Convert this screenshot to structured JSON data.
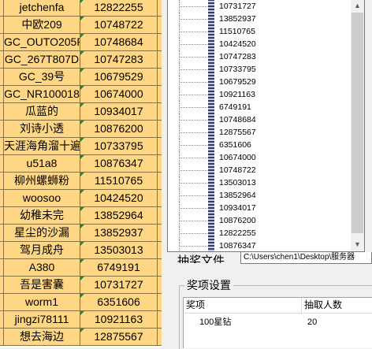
{
  "sheet": {
    "rows": [
      {
        "name": "jetchenfa",
        "value": "12822255"
      },
      {
        "name": "中欧209",
        "value": "10748722"
      },
      {
        "name": "GC_OUTO205R",
        "value": "10748684"
      },
      {
        "name": "GC_267T807D",
        "value": "10747283"
      },
      {
        "name": "GC_39号",
        "value": "10679529"
      },
      {
        "name": "GC_NR100018",
        "value": "10674000"
      },
      {
        "name": "瓜蓝的",
        "value": "10934017"
      },
      {
        "name": "刘诗小透",
        "value": "10876200"
      },
      {
        "name": "天涯海角溜十遍",
        "value": "10733795"
      },
      {
        "name": "u51a8",
        "value": "10876347"
      },
      {
        "name": "柳州螺蛳粉",
        "value": "11510765"
      },
      {
        "name": "woosoo",
        "value": "10424520"
      },
      {
        "name": "幼稚未完",
        "value": "13852964"
      },
      {
        "name": "星尘的沙漏",
        "value": "13852937"
      },
      {
        "name": "驾月成舟",
        "value": "13503013"
      },
      {
        "name": "A380",
        "value": "6749191"
      },
      {
        "name": "吾是害囊",
        "value": "10731727"
      },
      {
        "name": "worm1",
        "value": "6351606"
      },
      {
        "name": "jingzi78111",
        "value": "10921163"
      },
      {
        "name": "想去海边",
        "value": "12875567"
      }
    ]
  },
  "list": {
    "items": [
      "10731727",
      "13852937",
      "11510765",
      "10424520",
      "10747283",
      "10733795",
      "10679529",
      "10921163",
      "6749191",
      "10748684",
      "12875567",
      "6351606",
      "10674000",
      "10748722",
      "13503013",
      "13852964",
      "10934017",
      "10876200",
      "12822255",
      "10876347"
    ]
  },
  "file": {
    "label": "抽奖文件",
    "path": "C:\\Users\\chen1\\Desktop\\服务器"
  },
  "prizes": {
    "group_title": "奖项设置",
    "col_prize": "奖项",
    "col_count": "抽取人数",
    "rows": [
      {
        "prize": "100星钻",
        "count": "20"
      }
    ]
  },
  "colors": {
    "cell_fill": "#ffd684",
    "comment_marker": "#1a8a3a"
  }
}
